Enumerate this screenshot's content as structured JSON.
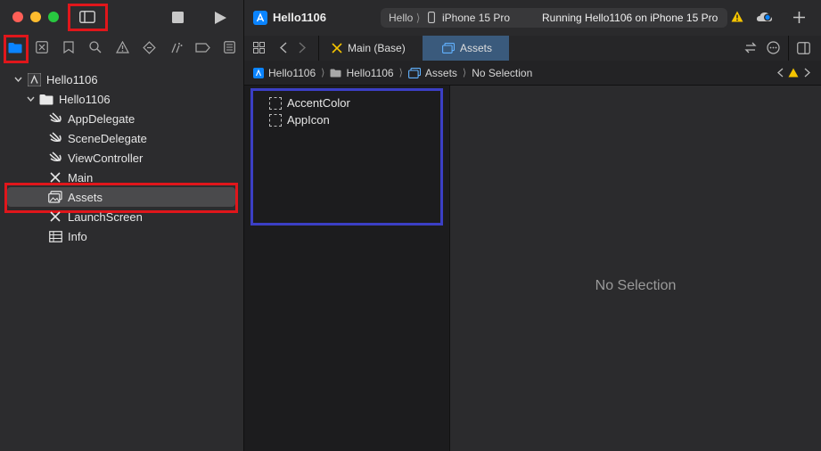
{
  "toolbar": {
    "project_name": "Hello1106",
    "scheme_short": "Hello",
    "device": "iPhone 15 Pro",
    "status": "Running Hello1106 on iPhone 15 Pro"
  },
  "tabs": [
    {
      "label": "Main (Base)"
    },
    {
      "label": "Assets"
    }
  ],
  "jumpbar": {
    "items": [
      "Hello1106",
      "Hello1106",
      "Assets",
      "No Selection"
    ]
  },
  "navigator": {
    "items": [
      {
        "label": "Hello1106"
      },
      {
        "label": "Hello1106"
      },
      {
        "label": "AppDelegate"
      },
      {
        "label": "SceneDelegate"
      },
      {
        "label": "ViewController"
      },
      {
        "label": "Main"
      },
      {
        "label": "Assets"
      },
      {
        "label": "LaunchScreen"
      },
      {
        "label": "Info"
      }
    ]
  },
  "asset_catalog": {
    "items": [
      "AccentColor",
      "AppIcon"
    ]
  },
  "detail": {
    "placeholder": "No Selection"
  },
  "colors": {
    "accent": "#0a84ff",
    "highlight_red": "#e0161b",
    "highlight_blue": "#3b3fc5",
    "warning": "#f5c400"
  }
}
